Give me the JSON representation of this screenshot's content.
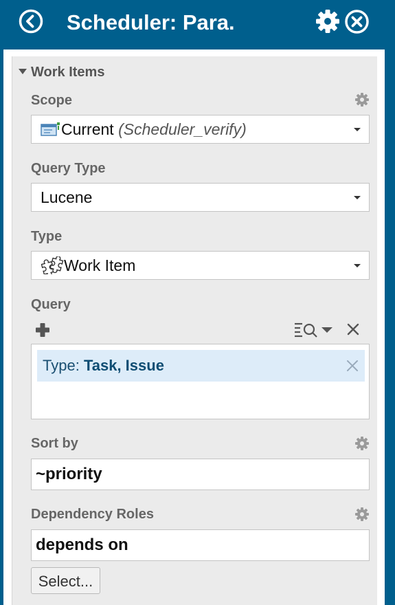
{
  "header": {
    "title": "Scheduler: Para."
  },
  "work_items": {
    "section_label": "Work Items",
    "scope": {
      "label": "Scope",
      "value": "Current",
      "context": "(Scheduler_verify)"
    },
    "query_type": {
      "label": "Query Type",
      "value": "Lucene"
    },
    "type": {
      "label": "Type",
      "value": "Work Item"
    },
    "query": {
      "label": "Query",
      "chip_key": "Type:",
      "chip_value": "Task, Issue"
    },
    "sort_by": {
      "label": "Sort by",
      "value": "~priority"
    },
    "dependency_roles": {
      "label": "Dependency Roles",
      "value": "depends on",
      "select_button": "Select..."
    }
  },
  "colors": {
    "header_bg": "#005f8d",
    "panel_bg": "#ebebeb",
    "chip_bg": "#ddecf9",
    "label_gray": "#666666"
  },
  "icons": {
    "back": "chevron-left-circle-icon",
    "settings": "gear-icon",
    "close": "close-circle-icon",
    "scope": "document-scope-icon",
    "type": "puzzle-icon",
    "add": "plus-icon",
    "query_tools": "list-search-icon",
    "clear": "close-icon"
  }
}
